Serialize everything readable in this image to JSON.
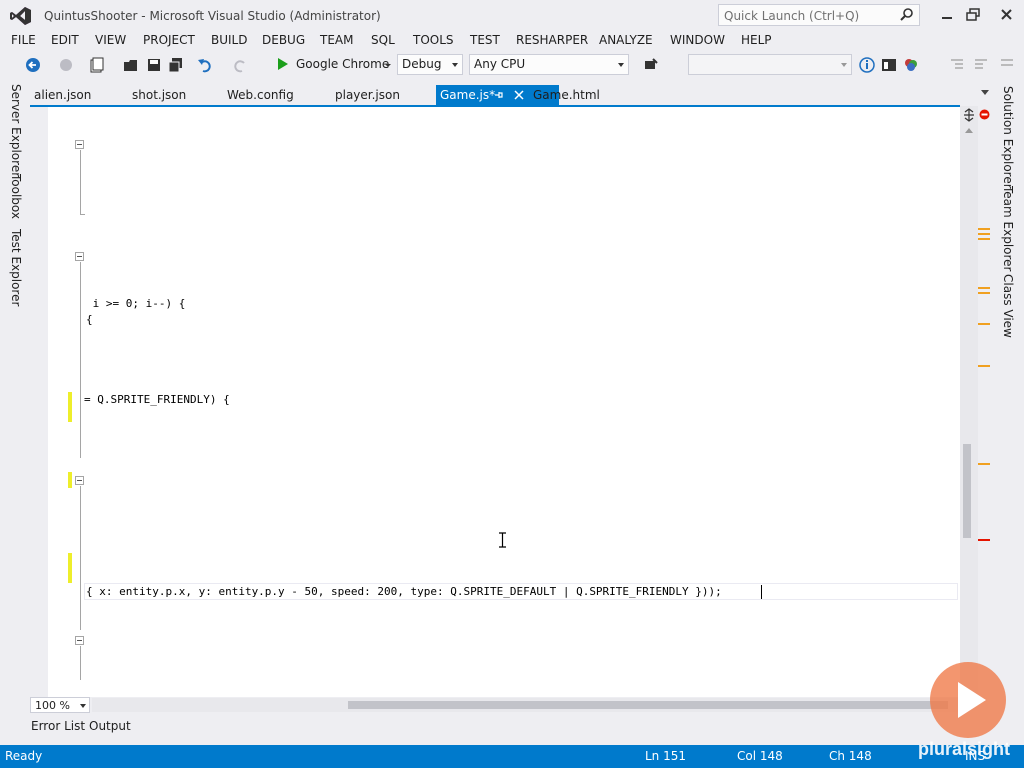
{
  "window": {
    "title": "QuintusShooter - Microsoft Visual Studio (Administrator)",
    "quick_launch_placeholder": "Quick Launch (Ctrl+Q)"
  },
  "menu": [
    "FILE",
    "EDIT",
    "VIEW",
    "PROJECT",
    "BUILD",
    "DEBUG",
    "TEAM",
    "SQL",
    "TOOLS",
    "TEST",
    "RESHARPER",
    "ANALYZE",
    "WINDOW",
    "HELP"
  ],
  "toolbar": {
    "run_label": "Google Chrome",
    "configuration": "Debug",
    "platform": "Any CPU",
    "search_combo": ""
  },
  "left_tool_windows": [
    "Server Explorer",
    "Toolbox",
    "Test Explorer"
  ],
  "right_tool_windows": [
    "Solution Explorer",
    "Team Explorer",
    "Class View"
  ],
  "doc_tabs": [
    {
      "label": "alien.json",
      "active": false
    },
    {
      "label": "shot.json",
      "active": false
    },
    {
      "label": "Web.config",
      "active": false
    },
    {
      "label": "player.json",
      "active": false
    },
    {
      "label": "Game.js*",
      "active": true
    },
    {
      "label": "Game.html",
      "active": false
    }
  ],
  "code_lines": [
    " i >= 0; i--) {",
    "{",
    "= Q.SPRITE_FRIENDLY) {",
    "{ x: entity.p.x, y: entity.p.y - 50, speed: 200, type: Q.SPRITE_DEFAULT | Q.SPRITE_FRIENDLY }));"
  ],
  "editor": {
    "zoom": "100 %"
  },
  "output_tabs": [
    "Error List",
    "Output"
  ],
  "status": {
    "state": "Ready",
    "line": "Ln 151",
    "col": "Col 148",
    "ch": "Ch 148",
    "mode": "INS"
  },
  "overlay": {
    "brand": "pluralsight"
  },
  "colors": {
    "accent": "#007acc",
    "change_marker": "#eeee2b",
    "play_green": "#1b9e1b"
  }
}
